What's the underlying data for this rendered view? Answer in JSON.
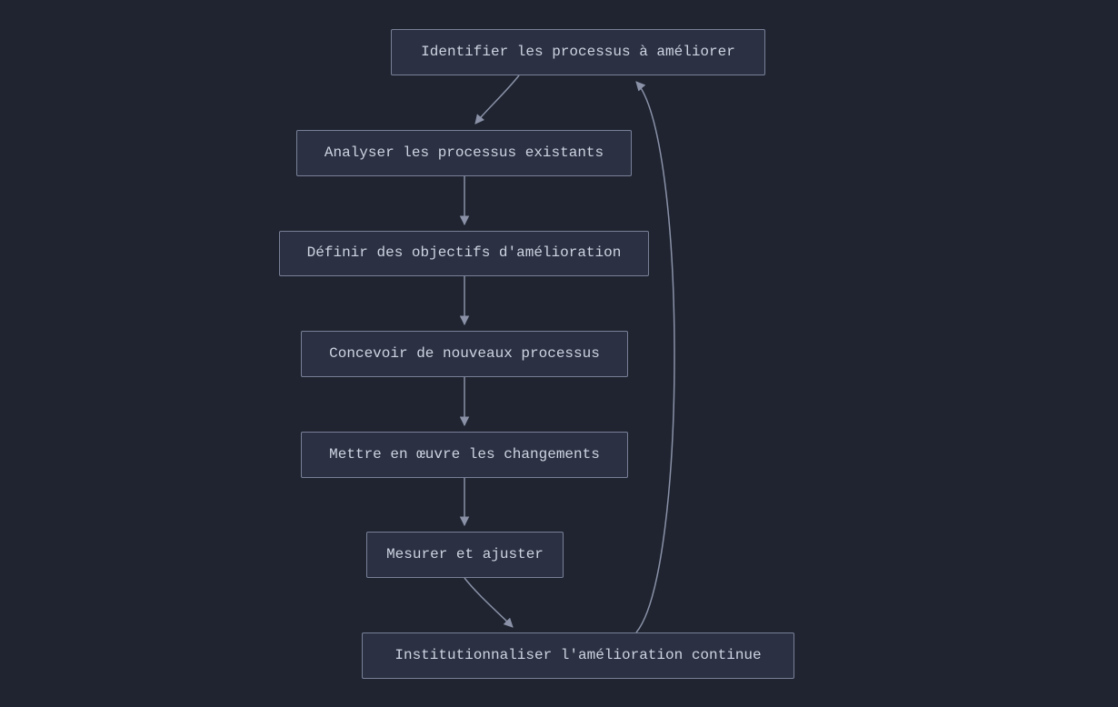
{
  "diagram": {
    "type": "flowchart",
    "direction": "top-down",
    "background": "#1f2430",
    "node_fill": "#2b3142",
    "node_stroke": "#798098",
    "edge_stroke": "#8b92a8",
    "text_color": "#cdd3e1",
    "font": "monospace",
    "nodes": [
      {
        "id": "n1",
        "label": "Identifier les processus à améliorer"
      },
      {
        "id": "n2",
        "label": "Analyser les processus existants"
      },
      {
        "id": "n3",
        "label": "Définir des objectifs d'amélioration"
      },
      {
        "id": "n4",
        "label": "Concevoir de nouveaux processus"
      },
      {
        "id": "n5",
        "label": "Mettre en œuvre les changements"
      },
      {
        "id": "n6",
        "label": "Mesurer et ajuster"
      },
      {
        "id": "n7",
        "label": "Institutionnaliser l'amélioration continue"
      }
    ],
    "edges": [
      {
        "from": "n1",
        "to": "n2"
      },
      {
        "from": "n2",
        "to": "n3"
      },
      {
        "from": "n3",
        "to": "n4"
      },
      {
        "from": "n4",
        "to": "n5"
      },
      {
        "from": "n5",
        "to": "n6"
      },
      {
        "from": "n6",
        "to": "n7"
      },
      {
        "from": "n7",
        "to": "n1",
        "loop": true
      }
    ]
  }
}
